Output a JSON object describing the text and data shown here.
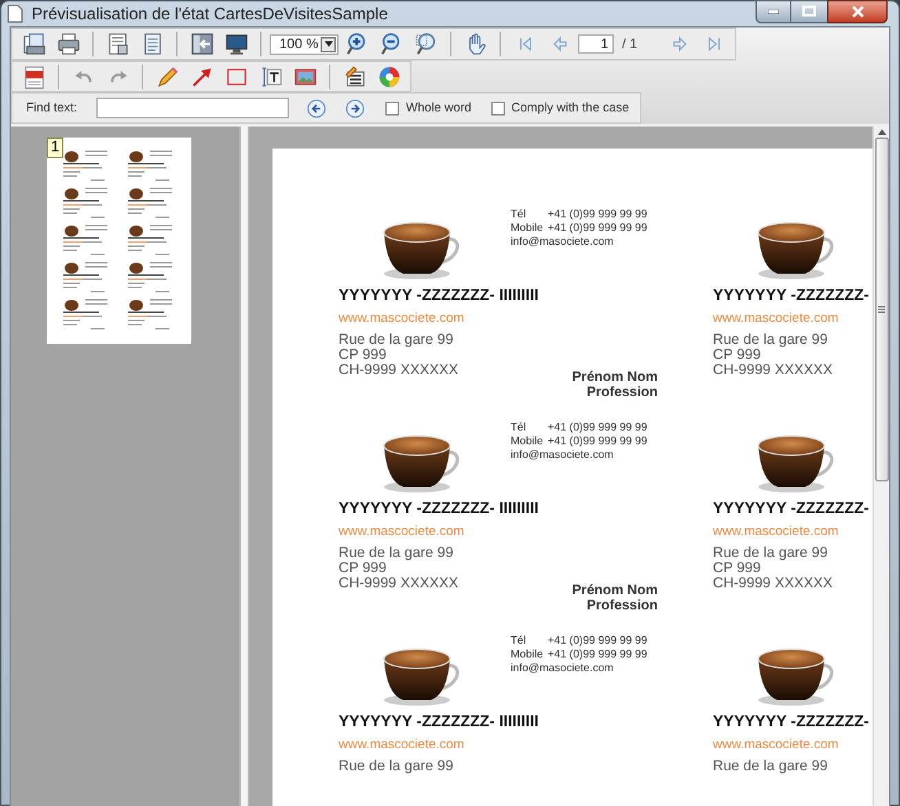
{
  "window": {
    "title": "Prévisualisation de l'état CartesDeVisitesSample"
  },
  "toolbar": {
    "zoom": "100 %",
    "page": "1",
    "page_total": "/ 1"
  },
  "find_bar": {
    "label": "Find text:",
    "options": [
      {
        "label": "Whole word",
        "checked": false
      },
      {
        "label": "Comply with the case",
        "checked": false
      }
    ]
  },
  "thumbnails": [
    {
      "label": "1",
      "selected": true
    }
  ],
  "cards": [
    {
      "phones": [
        {
          "label": "Tél",
          "value": "+41 (0)99 999 99 99"
        },
        {
          "label": "Mobile",
          "value": "+41 (0)99 999 99 99"
        }
      ],
      "email": "info@masociete.com",
      "title": "YYYYYYY -ZZZZZZZ- IIIIIIIII",
      "website": "www.mascociete.com",
      "address": [
        "Rue de la gare 99",
        "CP 999",
        "CH-9999 XXXXXX"
      ],
      "name": "Prénom Nom",
      "profession": "Profession"
    },
    {
      "title": "YYYYYYY -ZZZZZZZ-",
      "website": "www.mascociete.com",
      "address": [
        "Rue de la gare 99",
        "CP 999",
        "CH-9999 XXXXXX"
      ]
    },
    {
      "phones": [
        {
          "label": "Tél",
          "value": "+41 (0)99 999 99 99"
        },
        {
          "label": "Mobile",
          "value": "+41 (0)99 999 99 99"
        }
      ],
      "email": "info@masociete.com",
      "title": "YYYYYYY -ZZZZZZZ- IIIIIIIII",
      "website": "www.mascociete.com",
      "address": [
        "Rue de la gare 99",
        "CP 999",
        "CH-9999 XXXXXX"
      ],
      "name": "Prénom Nom",
      "profession": "Profession"
    },
    {
      "title": "YYYYYYY -ZZZZZZZ-",
      "website": "www.mascociete.com",
      "address": [
        "Rue de la gare 99",
        "CP 999",
        "CH-9999 XXXXXX"
      ]
    },
    {
      "phones": [
        {
          "label": "Tél",
          "value": "+41 (0)99 999 99 99"
        },
        {
          "label": "Mobile",
          "value": "+41 (0)99 999 99 99"
        }
      ],
      "email": "info@masociete.com",
      "title": "YYYYYYY -ZZZZZZZ- IIIIIIIII",
      "website": "www.mascociete.com",
      "address": [
        "Rue de la gare 99"
      ]
    },
    {
      "title": "YYYYYYY -ZZZZZZZ-",
      "website": "www.mascociete.com",
      "address": [
        "Rue de la gare 99"
      ]
    }
  ]
}
